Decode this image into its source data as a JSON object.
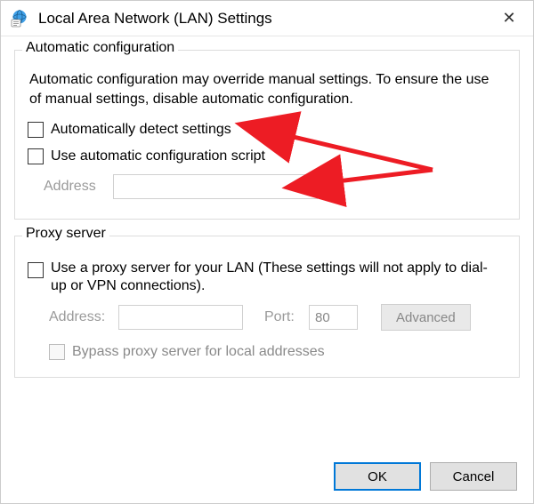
{
  "window": {
    "title": "Local Area Network (LAN) Settings"
  },
  "autoconfig": {
    "group_title": "Automatic configuration",
    "description": "Automatic configuration may override manual settings.  To ensure the use of manual settings, disable automatic configuration.",
    "detect_label": "Automatically detect settings",
    "script_label": "Use automatic configuration script",
    "address_label": "Address"
  },
  "proxy": {
    "group_title": "Proxy server",
    "use_proxy_label": "Use a proxy server for your LAN (These settings will not apply to dial-up or VPN connections).",
    "address_label": "Address:",
    "port_label": "Port:",
    "port_value": "80",
    "advanced_label": "Advanced",
    "bypass_label": "Bypass proxy server for local addresses"
  },
  "buttons": {
    "ok": "OK",
    "cancel": "Cancel"
  },
  "annotation": {
    "arrow_color": "#ed1c24"
  }
}
